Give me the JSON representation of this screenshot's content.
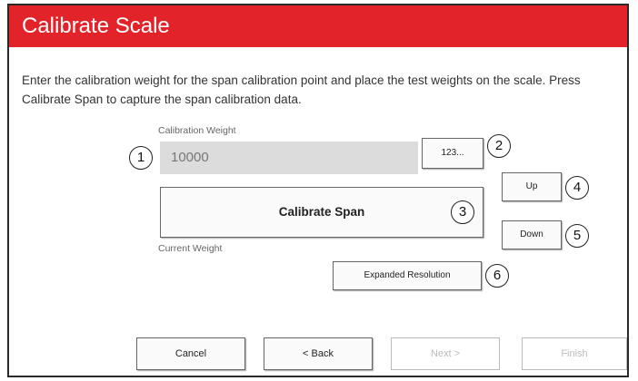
{
  "dialog": {
    "title": "Calibrate Scale",
    "instructions": "Enter the calibration weight for the span calibration point and place the test weights on the scale. Press Calibrate Span to capture the span calibration data."
  },
  "calibration_weight": {
    "label": "Calibration Weight",
    "value": "10000",
    "keypad_button": "123..."
  },
  "calibrate_span_button": "Calibrate Span",
  "current_weight_label": "Current Weight",
  "up_button": "Up",
  "down_button": "Down",
  "expanded_resolution_button": "Expanded Resolution",
  "footer": {
    "cancel": "Cancel",
    "back": "< Back",
    "next": "Next >",
    "finish": "Finish"
  },
  "callouts": [
    "1",
    "2",
    "3",
    "4",
    "5",
    "6"
  ]
}
